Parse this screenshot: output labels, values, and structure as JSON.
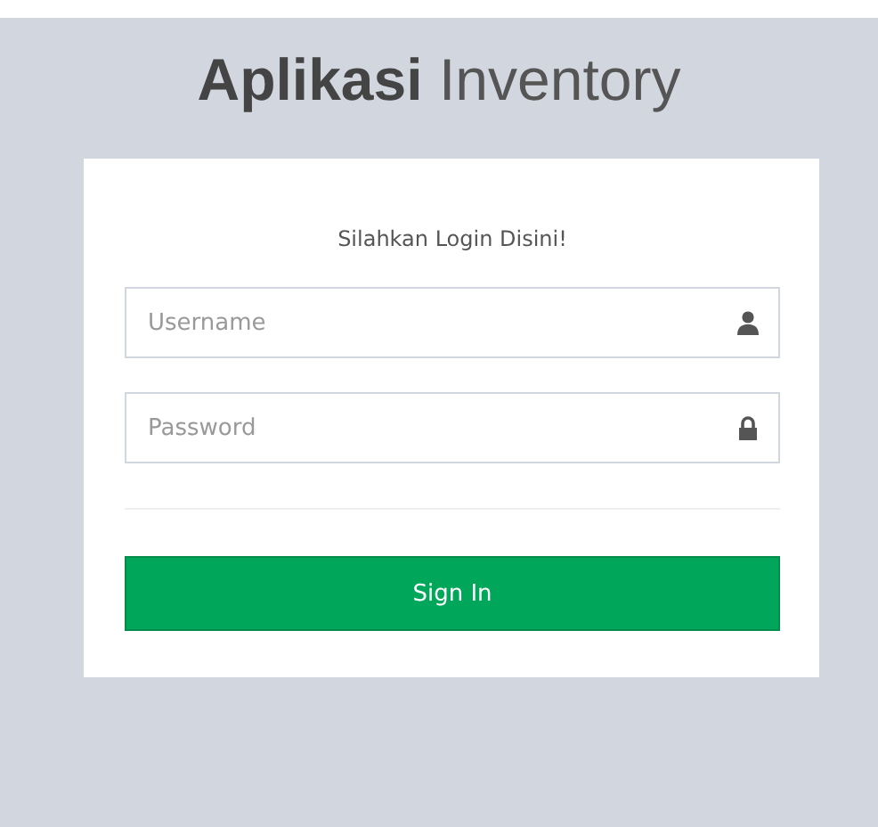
{
  "logo": {
    "bold": "Aplikasi",
    "light": "Inventory"
  },
  "login_box": {
    "message": "Silahkan Login Disini!",
    "fields": [
      {
        "kind": "user",
        "placeholder": "Username"
      },
      {
        "kind": "lock",
        "placeholder": "Password"
      }
    ],
    "button": "Sign In"
  }
}
